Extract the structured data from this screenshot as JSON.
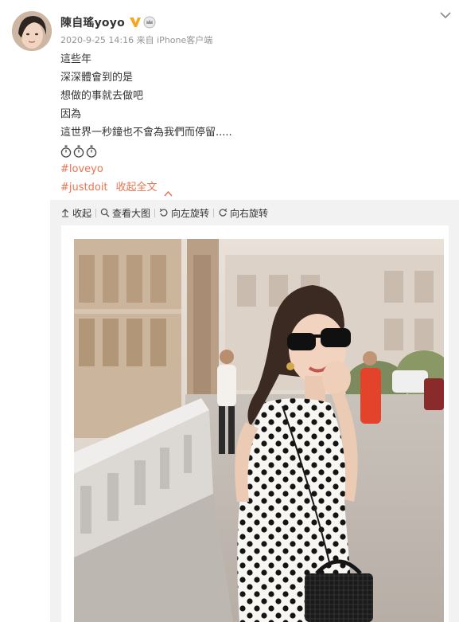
{
  "post": {
    "author": {
      "name": "陳自瑤yoyo"
    },
    "meta": {
      "timestamp": "2020-9-25 14:16",
      "source_prefix": "来自",
      "source": "iPhone客户端"
    },
    "lines": [
      "這些年",
      "深深體會到的是",
      "想做的事就去做吧",
      "因為",
      "這世界一秒鐘也不會為我們而停留....."
    ],
    "emoji": [
      "stopwatch-icon",
      "stopwatch-icon",
      "stopwatch-icon"
    ],
    "tags": [
      "#loveyo",
      "#justdoit"
    ],
    "collapse_label": "收起全文"
  },
  "media_toolbar": {
    "collapse": "收起",
    "view_large": "查看大图",
    "rotate_left": "向左旋转",
    "rotate_right": "向右旋转"
  },
  "colors": {
    "accent": "#eb7350",
    "verified_badge": "#f5a623",
    "panel_background": "#f2f2f2",
    "meta_text": "#939393"
  }
}
